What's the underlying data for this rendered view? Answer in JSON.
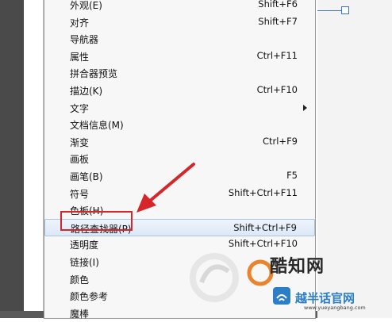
{
  "menu": {
    "items": [
      {
        "label": "外观(E)",
        "shortcut": "Shift+F6",
        "submenu": false,
        "highlighted": false
      },
      {
        "label": "对齐",
        "shortcut": "Shift+F7",
        "submenu": false,
        "highlighted": false
      },
      {
        "label": "导航器",
        "shortcut": "",
        "submenu": false,
        "highlighted": false
      },
      {
        "label": "属性",
        "shortcut": "Ctrl+F11",
        "submenu": false,
        "highlighted": false
      },
      {
        "label": "拼合器预览",
        "shortcut": "",
        "submenu": false,
        "highlighted": false
      },
      {
        "label": "描边(K)",
        "shortcut": "Ctrl+F10",
        "submenu": false,
        "highlighted": false
      },
      {
        "label": "文字",
        "shortcut": "",
        "submenu": true,
        "highlighted": false
      },
      {
        "label": "文档信息(M)",
        "shortcut": "",
        "submenu": false,
        "highlighted": false
      },
      {
        "label": "渐变",
        "shortcut": "Ctrl+F9",
        "submenu": false,
        "highlighted": false
      },
      {
        "label": "画板",
        "shortcut": "",
        "submenu": false,
        "highlighted": false
      },
      {
        "label": "画笔(B)",
        "shortcut": "F5",
        "submenu": false,
        "highlighted": false
      },
      {
        "label": "符号",
        "shortcut": "Shift+Ctrl+F11",
        "submenu": false,
        "highlighted": false
      },
      {
        "label": "色板(H)",
        "shortcut": "",
        "submenu": false,
        "highlighted": false
      },
      {
        "label": "路径查找器(P)",
        "shortcut": "Shift+Ctrl+F9",
        "submenu": false,
        "highlighted": true
      },
      {
        "label": "透明度",
        "shortcut": "Shift+Ctrl+F10",
        "submenu": false,
        "highlighted": false
      },
      {
        "label": "链接(I)",
        "shortcut": "",
        "submenu": false,
        "highlighted": false
      },
      {
        "label": "颜色",
        "shortcut": "",
        "submenu": false,
        "highlighted": false
      },
      {
        "label": "颜色参考",
        "shortcut": "",
        "submenu": false,
        "highlighted": false
      },
      {
        "label": "魔棒",
        "shortcut": "",
        "submenu": false,
        "highlighted": false
      }
    ]
  },
  "annotation": {
    "box_color": "#d6262a",
    "arrow_color": "#d6262a"
  },
  "watermark": {
    "name": "酷知网",
    "site_name": "越半话官网",
    "url": "www.yueyangbang.com"
  }
}
